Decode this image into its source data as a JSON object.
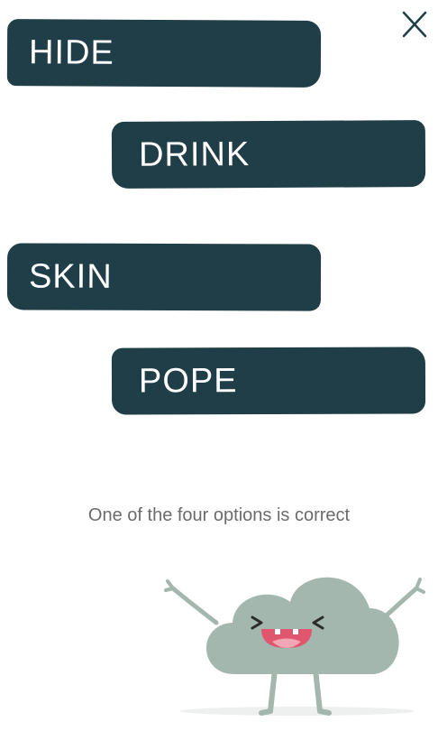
{
  "options": [
    {
      "label": "HIDE"
    },
    {
      "label": "DRINK"
    },
    {
      "label": "SKIN"
    },
    {
      "label": "POPE"
    }
  ],
  "hint_text": "One of the four options is correct",
  "icons": {
    "close": "close-icon",
    "mascot": "happy-cloud-mascot"
  },
  "colors": {
    "option_bg": "#1f3e48",
    "option_text": "#ffffff",
    "hint_text": "#6b6b6b",
    "cloud": "#a3b7ae",
    "mouth": "#e0566f"
  }
}
